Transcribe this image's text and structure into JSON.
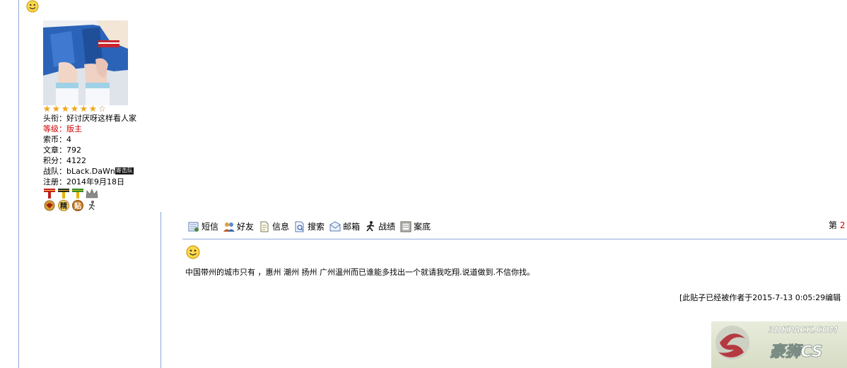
{
  "profile": {
    "stars_filled": 6,
    "stars_total": 7,
    "title_label": "头衔：",
    "title_value": "好讨厌呀这样看人家",
    "level_label": "等级：",
    "level_value": "版主",
    "coins_label": "索币：",
    "coins_value": "4",
    "posts_label": "文章：",
    "posts_value": "792",
    "points_label": "积分：",
    "points_value": "4122",
    "team_label": "战队：",
    "team_value": "bLack.DaWn",
    "team_badge": "寄击队",
    "registered_label": "注册：",
    "registered_value": "2014年9月18日",
    "medal_badges": [
      "精",
      "贴"
    ]
  },
  "toolbar": {
    "items": [
      {
        "label": "短信",
        "icon": "message-icon"
      },
      {
        "label": "好友",
        "icon": "friends-icon"
      },
      {
        "label": "信息",
        "icon": "info-icon"
      },
      {
        "label": "搜索",
        "icon": "search-icon"
      },
      {
        "label": "邮箱",
        "icon": "mail-icon"
      },
      {
        "label": "战绩",
        "icon": "record-icon"
      },
      {
        "label": "案底",
        "icon": "file-icon"
      }
    ],
    "floor_prefix": "第",
    "floor_number": "2"
  },
  "post": {
    "body": "中国带州的城市只有 ，惠州 潮州 扬州 广州温州而已谁能多找出一个就请我吃翔.说道做到.不信你找。",
    "edit_note": "[此贴子已经被作者于2015-7-13 0:05:29编辑"
  },
  "watermark": {
    "site": "3DKPACK.COM",
    "brand": "豪狮CS"
  },
  "colors": {
    "rule": "#8fa8d8",
    "level_red": "#cc0000",
    "floor_red": "#cc0000"
  }
}
